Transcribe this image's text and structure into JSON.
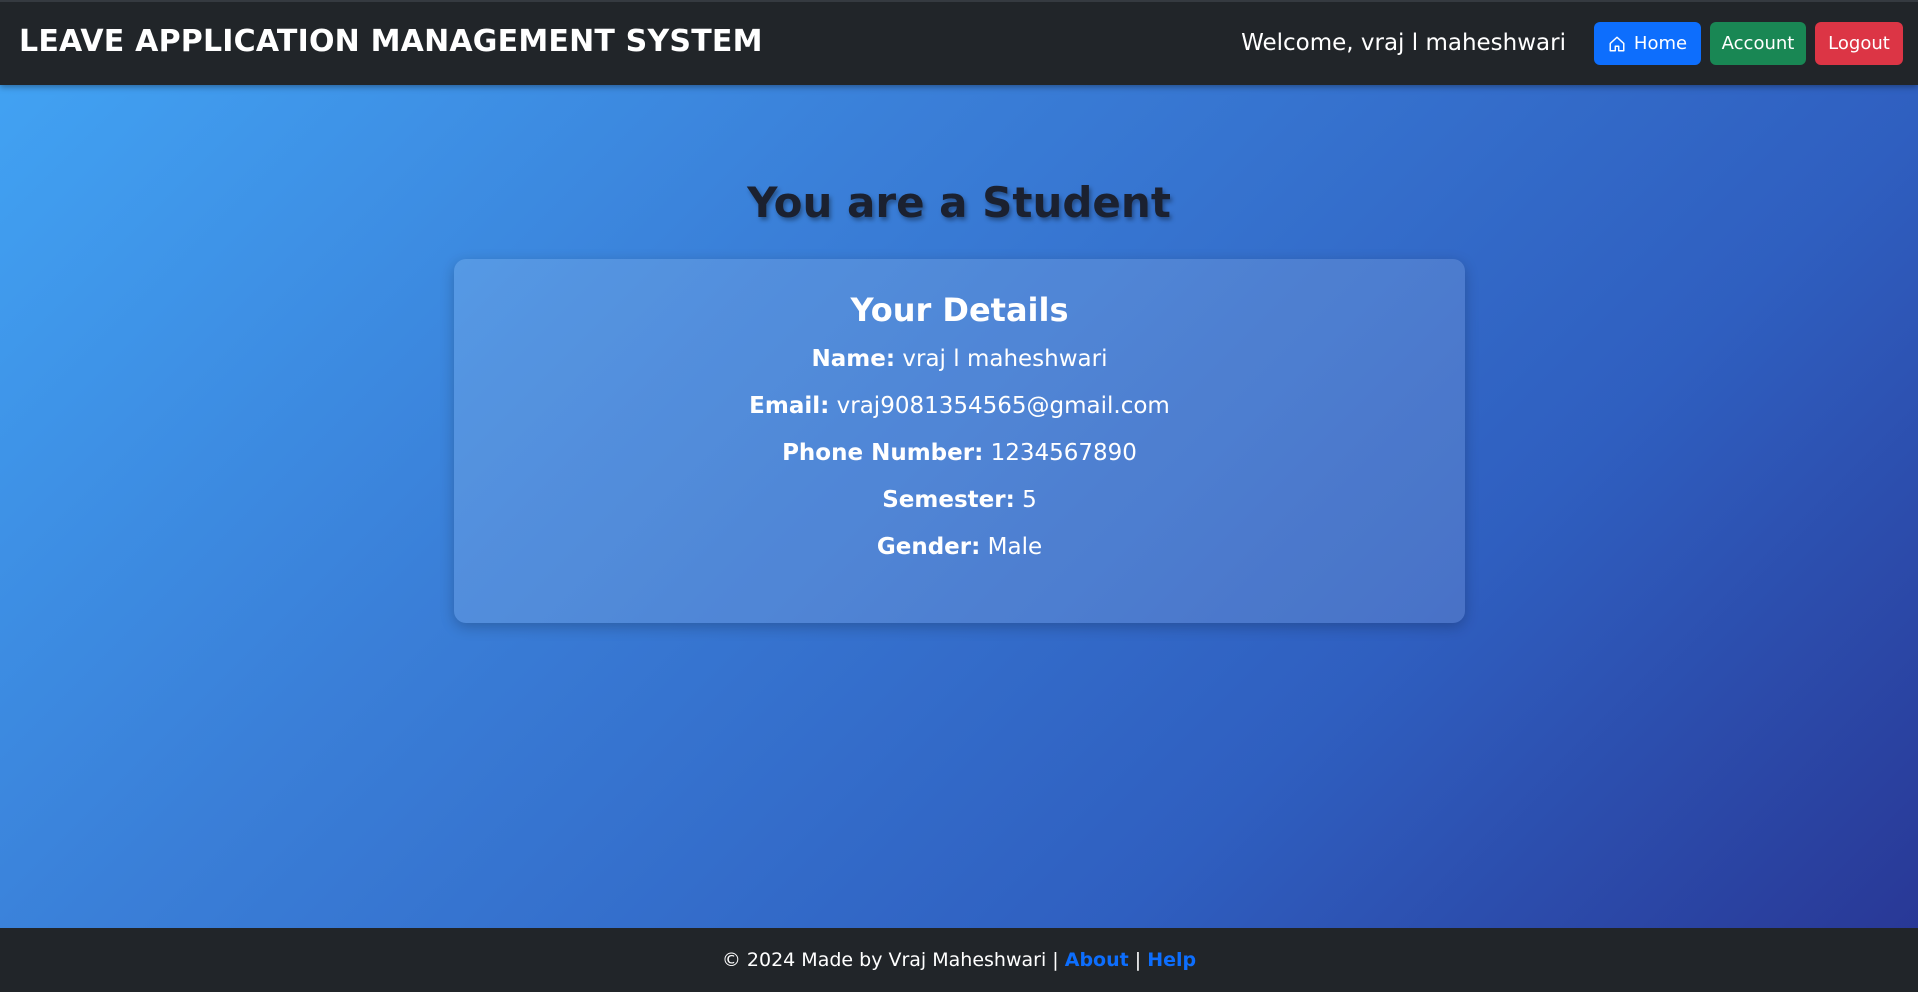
{
  "navbar": {
    "brand": "LEAVE APPLICATION MANAGEMENT SYSTEM",
    "welcome": "Welcome, vraj l maheshwari",
    "home_label": "Home",
    "account_label": "Account",
    "logout_label": "Logout"
  },
  "main": {
    "heading": "You are a Student",
    "card_title": "Your Details",
    "details": [
      {
        "label": "Name:",
        "value": "vraj l maheshwari"
      },
      {
        "label": "Email:",
        "value": "vraj9081354565@gmail.com"
      },
      {
        "label": "Phone Number:",
        "value": "1234567890"
      },
      {
        "label": "Semester:",
        "value": "5"
      },
      {
        "label": "Gender:",
        "value": "Male"
      }
    ]
  },
  "footer": {
    "copyright": "© 2024 Made by Vraj Maheshwari",
    "separator": "|",
    "about_label": "About",
    "help_label": "Help"
  },
  "colors": {
    "navbar_bg": "#212529",
    "home_btn": "#0d6efd",
    "account_btn": "#198754",
    "logout_btn": "#dc3545",
    "link": "#0d6efd"
  }
}
